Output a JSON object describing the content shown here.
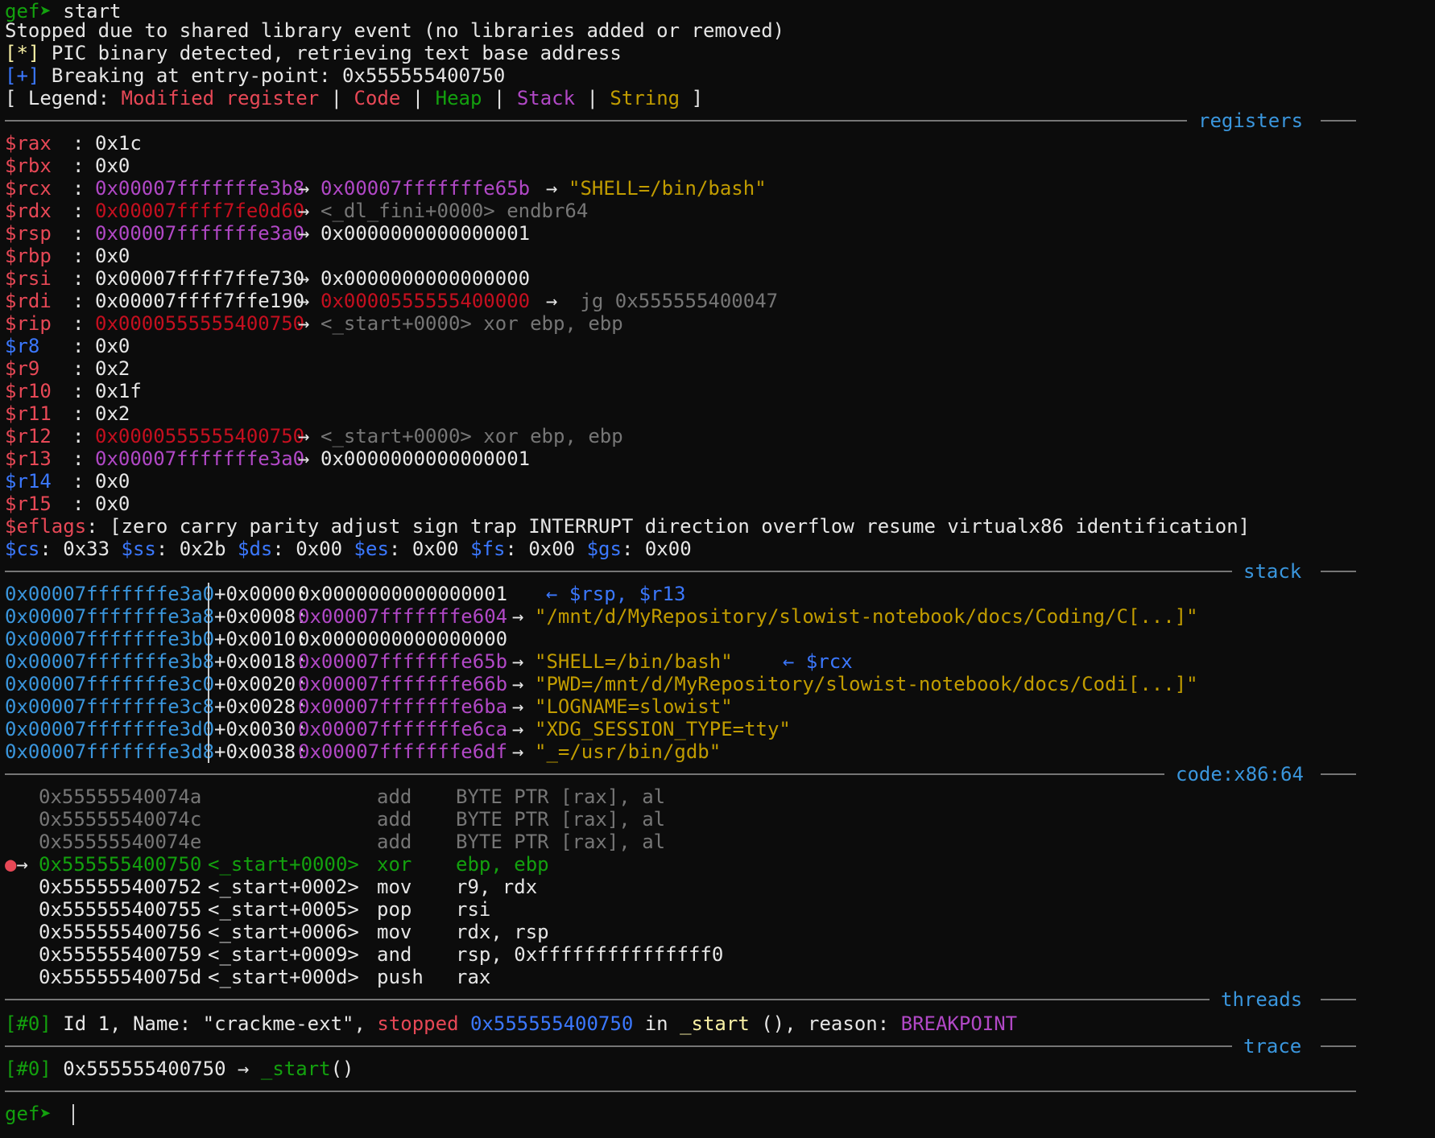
{
  "header": {
    "prompt": "gef➤",
    "command": "start",
    "msg_stopped": "Stopped due to shared library event (no libraries added or removed)",
    "info_star": "[*]",
    "info_pic": "PIC binary detected, retrieving text base address",
    "info_plus": "[+]",
    "info_break": "Breaking at entry-point: 0x555555400750"
  },
  "legend": {
    "open": "[ Legend: ",
    "modified": "Modified register",
    "code": "Code",
    "heap": "Heap",
    "stack": "Stack",
    "string": "String",
    "sep": " | ",
    "close": " ]"
  },
  "sections": {
    "registers": "registers",
    "stack": "stack",
    "code": "code:x86:64",
    "threads": "threads",
    "trace": "trace"
  },
  "arrow": "→",
  "back_arrow": "←",
  "registers": [
    {
      "name": "$rax",
      "value": "0x1c",
      "nc": "red",
      "vc": "white",
      "chain": []
    },
    {
      "name": "$rbx",
      "value": "0x0",
      "nc": "red",
      "vc": "white",
      "chain": []
    },
    {
      "name": "$rcx",
      "value": "0x00007fffffffe3b8",
      "nc": "red",
      "vc": "magenta",
      "chain": [
        {
          "t": "0x00007fffffffe65b",
          "c": "magenta"
        },
        {
          "t": "\"SHELL=/bin/bash\"",
          "c": "gold"
        }
      ]
    },
    {
      "name": "$rdx",
      "value": "0x00007ffff7fe0d60",
      "nc": "red",
      "vc": "darkred",
      "chain": [
        {
          "t": "<_dl_fini+0000> endbr64",
          "c": "gray"
        }
      ]
    },
    {
      "name": "$rsp",
      "value": "0x00007fffffffe3a0",
      "nc": "red",
      "vc": "magenta",
      "chain": [
        {
          "t": "0x0000000000000001",
          "c": "white"
        }
      ]
    },
    {
      "name": "$rbp",
      "value": "0x0",
      "nc": "red",
      "vc": "white",
      "chain": []
    },
    {
      "name": "$rsi",
      "value": "0x00007ffff7ffe730",
      "nc": "red",
      "vc": "white",
      "chain": [
        {
          "t": "0x0000000000000000",
          "c": "white"
        }
      ]
    },
    {
      "name": "$rdi",
      "value": "0x00007ffff7ffe190",
      "nc": "red",
      "vc": "white",
      "chain": [
        {
          "t": "0x0000555555400000",
          "c": "darkred"
        },
        {
          "t": " jg 0x555555400047",
          "c": "gray"
        }
      ]
    },
    {
      "name": "$rip",
      "value": "0x0000555555400750",
      "nc": "red",
      "vc": "darkred",
      "chain": [
        {
          "t": "<_start+0000> xor ebp, ebp",
          "c": "gray"
        }
      ]
    },
    {
      "name": "$r8",
      "value": "0x0",
      "nc": "blue",
      "vc": "white",
      "chain": []
    },
    {
      "name": "$r9",
      "value": "0x2",
      "nc": "red",
      "vc": "white",
      "chain": []
    },
    {
      "name": "$r10",
      "value": "0x1f",
      "nc": "red",
      "vc": "white",
      "chain": []
    },
    {
      "name": "$r11",
      "value": "0x2",
      "nc": "red",
      "vc": "white",
      "chain": []
    },
    {
      "name": "$r12",
      "value": "0x0000555555400750",
      "nc": "red",
      "vc": "darkred",
      "chain": [
        {
          "t": "<_start+0000> xor ebp, ebp",
          "c": "gray"
        }
      ]
    },
    {
      "name": "$r13",
      "value": "0x00007fffffffe3a0",
      "nc": "red",
      "vc": "magenta",
      "chain": [
        {
          "t": "0x0000000000000001",
          "c": "white"
        }
      ]
    },
    {
      "name": "$r14",
      "value": "0x0",
      "nc": "blue",
      "vc": "white",
      "chain": []
    },
    {
      "name": "$r15",
      "value": "0x0",
      "nc": "red",
      "vc": "white",
      "chain": []
    }
  ],
  "eflags": {
    "name": "$eflags",
    "value": "[zero carry parity adjust sign trap INTERRUPT direction overflow resume virtualx86 identification]"
  },
  "segments": [
    {
      "name": "$cs",
      "value": "0x33"
    },
    {
      "name": "$ss",
      "value": "0x2b"
    },
    {
      "name": "$ds",
      "value": "0x00"
    },
    {
      "name": "$es",
      "value": "0x00"
    },
    {
      "name": "$fs",
      "value": "0x00"
    },
    {
      "name": "$gs",
      "value": "0x00"
    }
  ],
  "stack": [
    {
      "addr": "0x00007fffffffe3a0",
      "off": "+0x0000:",
      "val": "0x0000000000000001",
      "vc": "white",
      "str": "",
      "note": "← $rsp, $r13"
    },
    {
      "addr": "0x00007fffffffe3a8",
      "off": "+0x0008:",
      "val": "0x00007fffffffe604",
      "vc": "magenta",
      "str": "\"/mnt/d/MyRepository/slowist-notebook/docs/Coding/C[...]\"",
      "note": ""
    },
    {
      "addr": "0x00007fffffffe3b0",
      "off": "+0x0010:",
      "val": "0x0000000000000000",
      "vc": "white",
      "str": "",
      "note": ""
    },
    {
      "addr": "0x00007fffffffe3b8",
      "off": "+0x0018:",
      "val": "0x00007fffffffe65b",
      "vc": "magenta",
      "str": "\"SHELL=/bin/bash\"",
      "note": "← $rcx"
    },
    {
      "addr": "0x00007fffffffe3c0",
      "off": "+0x0020:",
      "val": "0x00007fffffffe66b",
      "vc": "magenta",
      "str": "\"PWD=/mnt/d/MyRepository/slowist-notebook/docs/Codi[...]\"",
      "note": ""
    },
    {
      "addr": "0x00007fffffffe3c8",
      "off": "+0x0028:",
      "val": "0x00007fffffffe6ba",
      "vc": "magenta",
      "str": "\"LOGNAME=slowist\"",
      "note": ""
    },
    {
      "addr": "0x00007fffffffe3d0",
      "off": "+0x0030:",
      "val": "0x00007fffffffe6ca",
      "vc": "magenta",
      "str": "\"XDG_SESSION_TYPE=tty\"",
      "note": ""
    },
    {
      "addr": "0x00007fffffffe3d8",
      "off": "+0x0038:",
      "val": "0x00007fffffffe6df",
      "vc": "magenta",
      "str": "\"_=/usr/bin/gdb\"",
      "note": ""
    }
  ],
  "code": [
    {
      "marker": "",
      "addr": "0x55555540074a",
      "sym": "",
      "op": "add",
      "args": "BYTE PTR [rax], al",
      "state": "past"
    },
    {
      "marker": "",
      "addr": "0x55555540074c",
      "sym": "",
      "op": "add",
      "args": "BYTE PTR [rax], al",
      "state": "past"
    },
    {
      "marker": "",
      "addr": "0x55555540074e",
      "sym": "",
      "op": "add",
      "args": "BYTE PTR [rax], al",
      "state": "past"
    },
    {
      "marker": "●→",
      "addr": "0x555555400750",
      "sym": "<_start+0000>",
      "op": "xor",
      "args": "ebp, ebp",
      "state": "current"
    },
    {
      "marker": "",
      "addr": "0x555555400752",
      "sym": "<_start+0002>",
      "op": "mov",
      "args": "r9, rdx",
      "state": "future"
    },
    {
      "marker": "",
      "addr": "0x555555400755",
      "sym": "<_start+0005>",
      "op": "pop",
      "args": "rsi",
      "state": "future"
    },
    {
      "marker": "",
      "addr": "0x555555400756",
      "sym": "<_start+0006>",
      "op": "mov",
      "args": "rdx, rsp",
      "state": "future"
    },
    {
      "marker": "",
      "addr": "0x555555400759",
      "sym": "<_start+0009>",
      "op": "and",
      "args": "rsp, 0xfffffffffffffff0",
      "state": "future"
    },
    {
      "marker": "",
      "addr": "0x55555540075d",
      "sym": "<_start+000d>",
      "op": "push",
      "args": "rax",
      "state": "future"
    }
  ],
  "threads": {
    "idx": "[#0]",
    "p1": " Id 1, Name: \"crackme-ext\", ",
    "status": "stopped",
    "addr": "0x555555400750",
    "p2": " in ",
    "func": "_start",
    "p3": " (), reason: ",
    "reason": "BREAKPOINT"
  },
  "trace": {
    "idx": "[#0]",
    "addr": "0x555555400750",
    "func": "_start",
    "tail": "()"
  },
  "footer": {
    "prompt": "gef➤"
  }
}
